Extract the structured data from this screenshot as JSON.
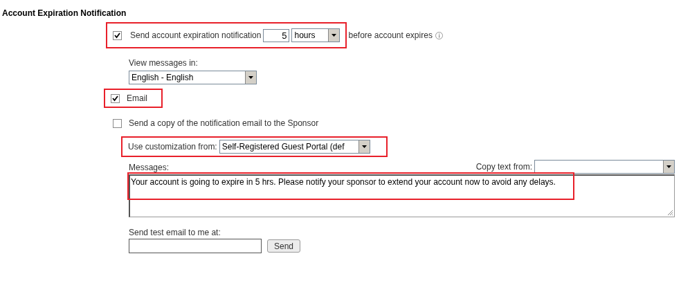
{
  "section_title": "Account Expiration Notification",
  "notify": {
    "checked": true,
    "label": "Send account expiration notification",
    "amount": "5",
    "unit": "hours",
    "suffix": "before account expires",
    "highlighted": true
  },
  "language": {
    "label": "View messages in:",
    "value": "English - English"
  },
  "email": {
    "checked": true,
    "label": "Email",
    "highlighted": true
  },
  "sponsor_copy": {
    "checked": false,
    "label": "Send a copy of the notification email to the Sponsor"
  },
  "customization": {
    "label": "Use customization from:",
    "value": "Self-Registered Guest Portal (def",
    "highlighted": true
  },
  "messages": {
    "label": "Messages:",
    "copy_label": "Copy text from:",
    "text": "Your account is going to expire in 5 hrs. Please notify your sponsor to extend your account now to avoid any delays.",
    "highlighted": true
  },
  "test_email": {
    "label": "Send test email to me at:",
    "button": "Send"
  }
}
